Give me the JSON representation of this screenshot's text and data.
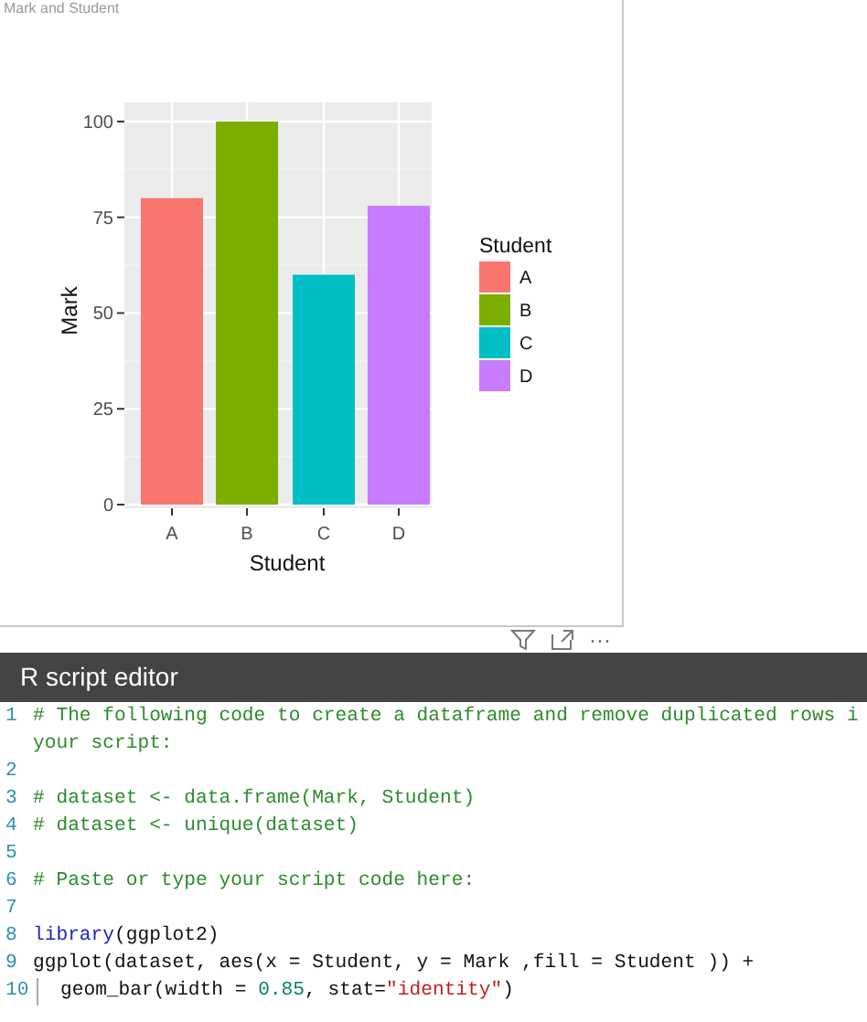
{
  "visual": {
    "title": "Mark and Student",
    "chart_data": {
      "type": "bar",
      "xlabel": "Student",
      "ylabel": "Mark",
      "categories": [
        "A",
        "B",
        "C",
        "D"
      ],
      "values": [
        80,
        100,
        60,
        78
      ],
      "grid": true,
      "colors": [
        "#f8766d",
        "#7cae00",
        "#00bfc4",
        "#c77cff"
      ],
      "ylim": [
        0,
        105
      ],
      "yticks": [
        0,
        25,
        50,
        75,
        100
      ]
    },
    "legend": {
      "title": "Student",
      "items": [
        {
          "label": "A",
          "color": "#f8766d"
        },
        {
          "label": "B",
          "color": "#7cae00"
        },
        {
          "label": "C",
          "color": "#00bfc4"
        },
        {
          "label": "D",
          "color": "#c77cff"
        }
      ]
    },
    "actions": [
      {
        "kind": "filter"
      },
      {
        "kind": "focus"
      },
      {
        "kind": "more",
        "text": "···"
      }
    ]
  },
  "editor": {
    "title": "R script editor",
    "lines": [
      {
        "number": "1",
        "tokens": [
          {
            "kind": "comment",
            "text": "# The following code to create a dataframe and remove duplicated rows i"
          }
        ],
        "continuation": [
          {
            "kind": "comment",
            "text": "your script:"
          }
        ]
      },
      {
        "number": "2"
      },
      {
        "number": "3",
        "tokens": [
          {
            "kind": "comment",
            "text": "# dataset <- data.frame(Mark, Student)"
          }
        ]
      },
      {
        "number": "4",
        "tokens": [
          {
            "kind": "comment",
            "text": "# dataset <- unique(dataset)"
          }
        ]
      },
      {
        "number": "5"
      },
      {
        "number": "6",
        "tokens": [
          {
            "kind": "comment",
            "text": "# Paste or type your script code here:"
          }
        ]
      },
      {
        "number": "7"
      },
      {
        "number": "8",
        "tokens": [
          {
            "kind": "keyword",
            "text": "library"
          },
          {
            "kind": "plain",
            "text": "(ggplot2)"
          }
        ]
      },
      {
        "number": "9",
        "tokens": [
          {
            "kind": "plain",
            "text": "ggplot(dataset, aes(x = Student, y = Mark ,fill = Student )) +"
          }
        ]
      },
      {
        "number": "10",
        "tokens": [
          {
            "kind": "plain",
            "text": "geom_bar(width = "
          },
          {
            "kind": "number",
            "text": "0.85"
          },
          {
            "kind": "plain",
            "text": ", stat="
          },
          {
            "kind": "string",
            "text": "\"identity\""
          },
          {
            "kind": "plain",
            "text": ")"
          }
        ],
        "indented": true
      }
    ]
  }
}
